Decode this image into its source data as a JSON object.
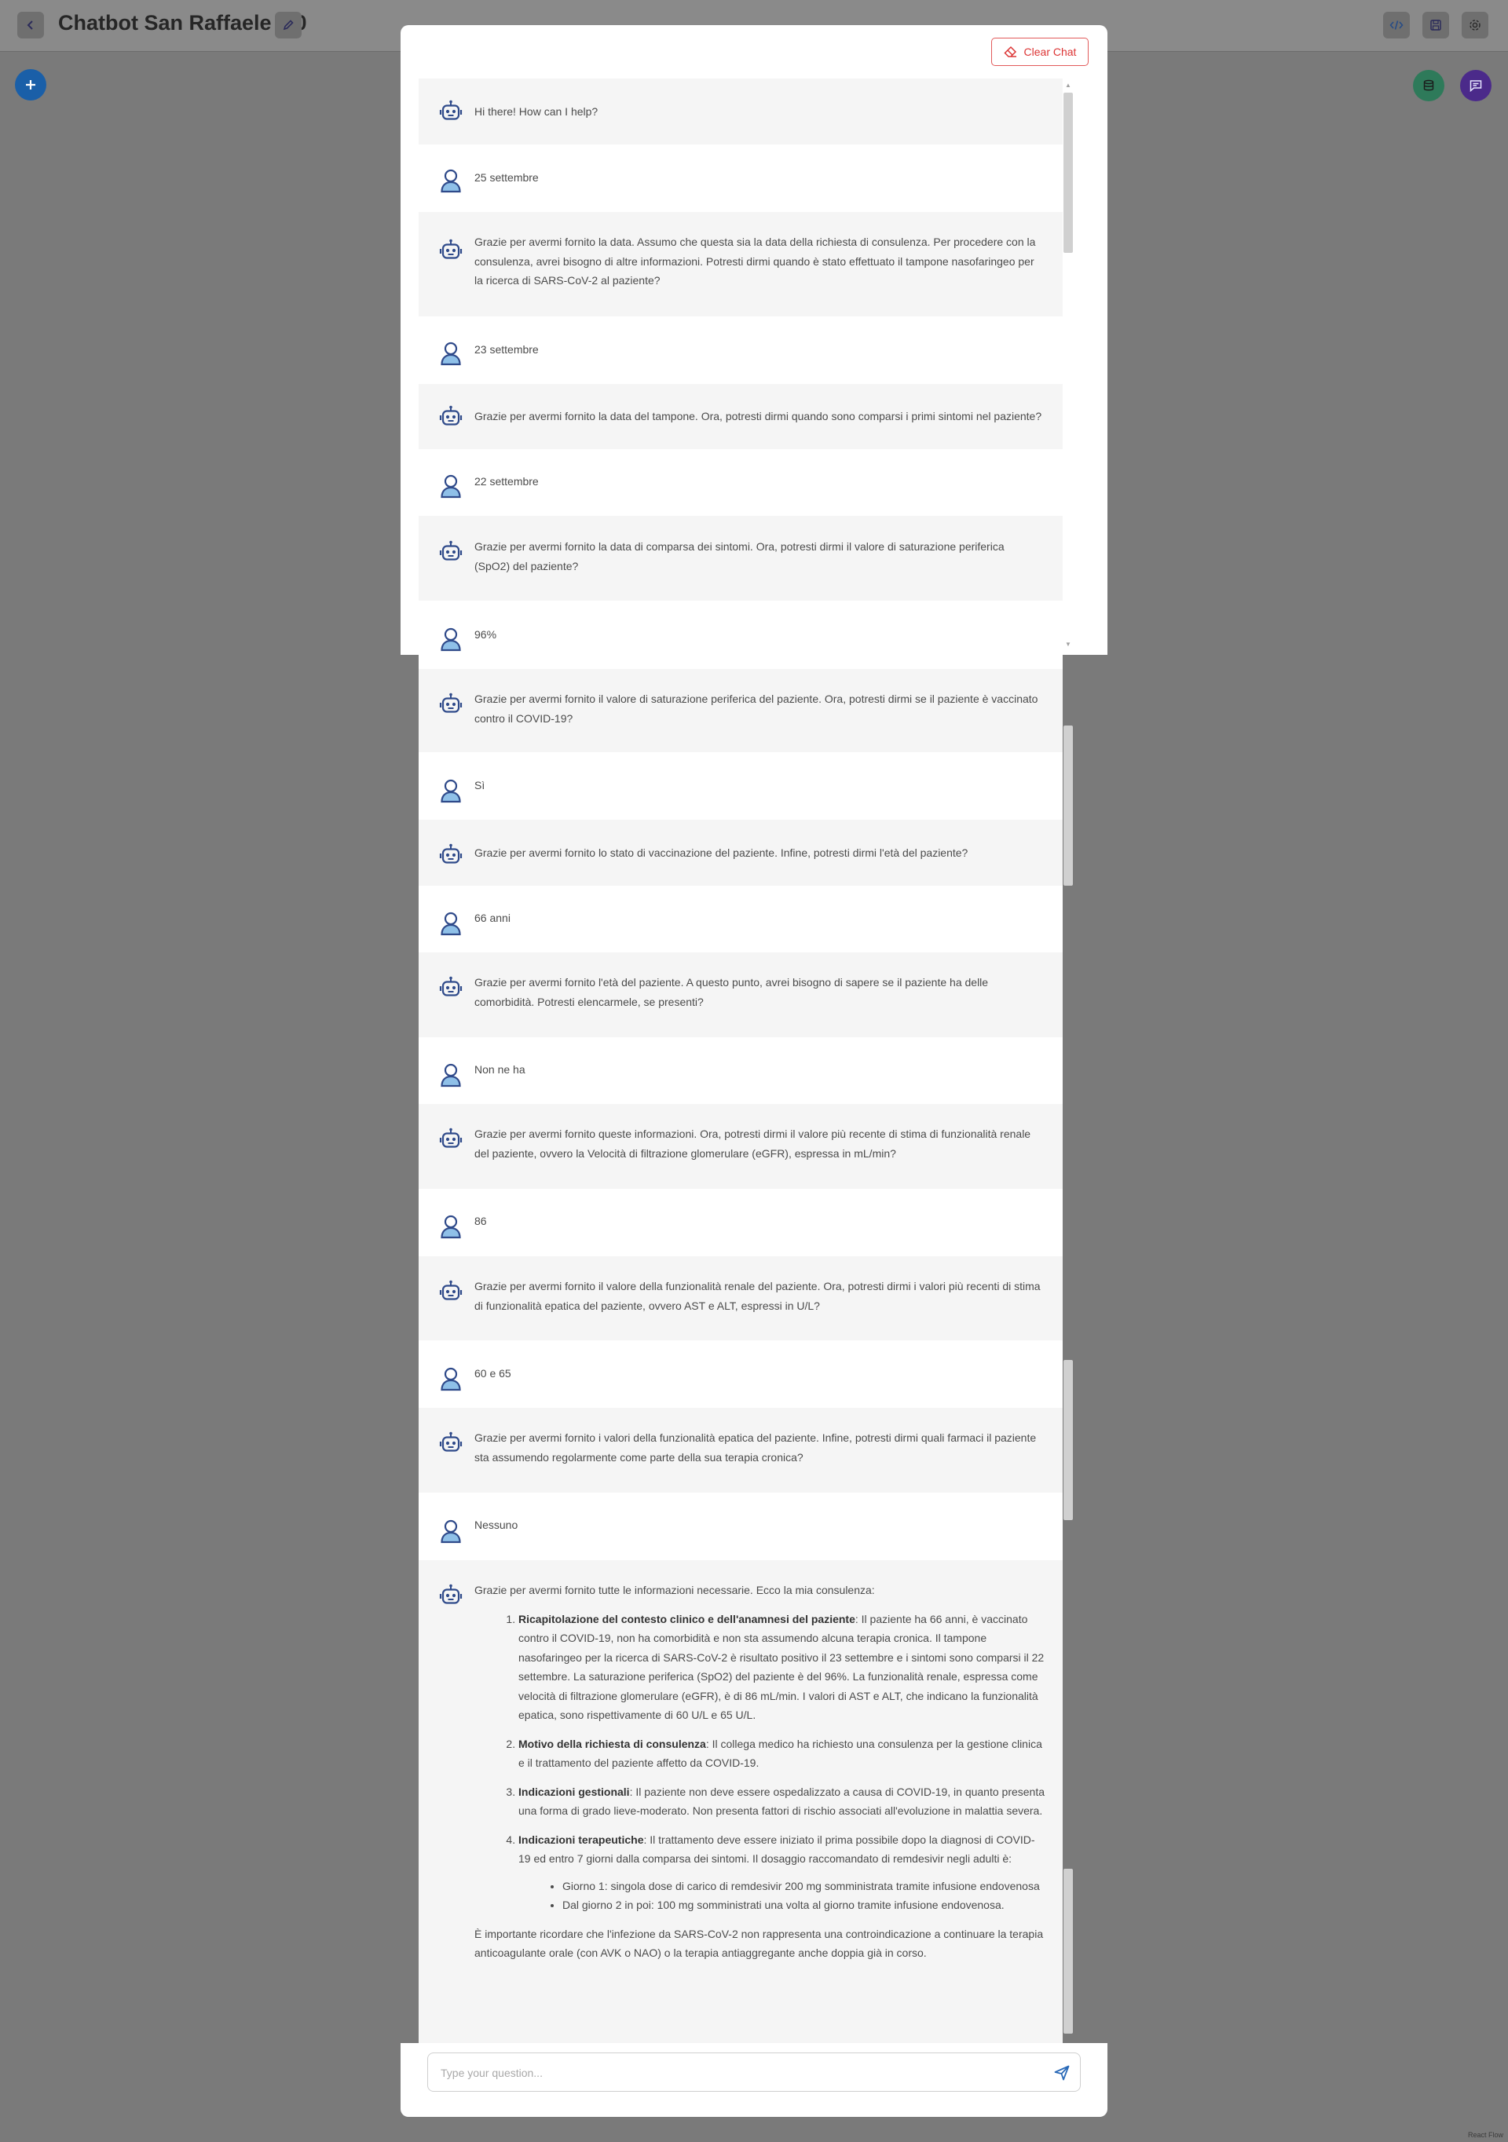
{
  "header": {
    "title": "Chatbot San Raffaele 2.0",
    "back_icon": "chevron-left-icon",
    "edit_icon": "pencil-icon",
    "code_icon": "code-icon",
    "save_icon": "save-icon",
    "settings_icon": "gear-icon"
  },
  "fab": {
    "add_icon": "plus-icon",
    "db_icon": "database-icon",
    "chat_icon": "chat-icon"
  },
  "chat": {
    "clear_label": "Clear Chat",
    "input_placeholder": "Type your question...",
    "messages": [
      {
        "role": "bot",
        "text": "Hi there! How can I help?"
      },
      {
        "role": "user",
        "text": "25 settembre"
      },
      {
        "role": "bot",
        "text": "Grazie per avermi fornito la data. Assumo che questa sia la data della richiesta di consulenza. Per procedere con la consulenza, avrei bisogno di altre informazioni. Potresti dirmi quando è stato effettuato il tampone nasofaringeo per la ricerca di SARS-CoV-2 al paziente?"
      },
      {
        "role": "user",
        "text": "23 settembre"
      },
      {
        "role": "bot",
        "text": "Grazie per avermi fornito la data del tampone. Ora, potresti dirmi quando sono comparsi i primi sintomi nel paziente?"
      },
      {
        "role": "user",
        "text": "22 settembre"
      },
      {
        "role": "bot",
        "text": "Grazie per avermi fornito la data di comparsa dei sintomi. Ora, potresti dirmi il valore di saturazione periferica (SpO2) del paziente?"
      },
      {
        "role": "user",
        "text": "96%"
      },
      {
        "role": "bot",
        "text": "Grazie per avermi fornito il valore di saturazione periferica del paziente. Ora, potresti dirmi se il paziente è vaccinato contro il COVID-19?"
      },
      {
        "role": "user",
        "text": "Sì"
      },
      {
        "role": "bot",
        "text": "Grazie per avermi fornito lo stato di vaccinazione del paziente. Infine, potresti dirmi l'età del paziente?"
      },
      {
        "role": "user",
        "text": "66 anni"
      },
      {
        "role": "bot",
        "text": "Grazie per avermi fornito l'età del paziente. A questo punto, avrei bisogno di sapere se il paziente ha delle comorbidità. Potresti elencarmele, se presenti?"
      },
      {
        "role": "user",
        "text": "Non ne ha"
      },
      {
        "role": "bot",
        "text": "Grazie per avermi fornito queste informazioni. Ora, potresti dirmi il valore più recente di stima di funzionalità renale del paziente, ovvero la Velocità di filtrazione glomerulare (eGFR), espressa in mL/min?"
      },
      {
        "role": "user",
        "text": "86"
      },
      {
        "role": "bot",
        "text": "Grazie per avermi fornito il valore della funzionalità renale del paziente. Ora, potresti dirmi i valori più recenti di stima di funzionalità epatica del paziente, ovvero AST e ALT, espressi in U/L?"
      },
      {
        "role": "user",
        "text": "60 e 65"
      },
      {
        "role": "bot",
        "text": "Grazie per avermi fornito i valori della funzionalità epatica del paziente. Infine, potresti dirmi quali farmaci il paziente sta assumendo regolarmente come parte della sua terapia cronica?"
      },
      {
        "role": "user",
        "text": "Nessuno"
      }
    ],
    "final": {
      "intro": "Grazie per avermi fornito tutte le informazioni necessarie. Ecco la mia consulenza:",
      "items": [
        {
          "title": "Ricapitolazione del contesto clinico e dell'anamnesi del paziente",
          "text": ": Il paziente ha 66 anni, è vaccinato contro il COVID-19, non ha comorbidità e non sta assumendo alcuna terapia cronica. Il tampone nasofaringeo per la ricerca di SARS-CoV-2 è risultato positivo il 23 settembre e i sintomi sono comparsi il 22 settembre. La saturazione periferica (SpO2) del paziente è del 96%. La funzionalità renale, espressa come velocità di filtrazione glomerulare (eGFR), è di 86 mL/min. I valori di AST e ALT, che indicano la funzionalità epatica, sono rispettivamente di 60 U/L e 65 U/L."
        },
        {
          "title": "Motivo della richiesta di consulenza",
          "text": ": Il collega medico ha richiesto una consulenza per la gestione clinica e il trattamento del paziente affetto da COVID-19."
        },
        {
          "title": "Indicazioni gestionali",
          "text": ": Il paziente non deve essere ospedalizzato a causa di COVID-19, in quanto presenta una forma di grado lieve-moderato. Non presenta fattori di rischio associati all'evoluzione in malattia severa."
        },
        {
          "title": "Indicazioni terapeutiche",
          "text": ": Il trattamento deve essere iniziato il prima possibile dopo la diagnosi di COVID-19 ed entro 7 giorni dalla comparsa dei sintomi. Il dosaggio raccomandato di remdesivir negli adulti è:"
        }
      ],
      "sub_items": [
        "Giorno 1: singola dose di carico di remdesivir 200 mg somministrata tramite infusione endovenosa",
        "Dal giorno 2 in poi: 100 mg somministrati una volta al giorno tramite infusione endovenosa."
      ],
      "outro": "È importante ricordare che l'infezione da SARS-CoV-2 non rappresenta una controindicazione a continuare la terapia anticoagulante orale (con AVK o NAO) o la terapia antiaggregante anche doppia già in corso."
    }
  },
  "footer": {
    "attribution": "React Flow"
  },
  "colors": {
    "backdrop": "#7a7a7a",
    "bot_bg": "#f5f5f5",
    "accent_red": "#dc3535",
    "avatar_blue": "#2f4a8a",
    "fab_blue": "#1a5fa8",
    "fab_green": "#2e7a5a",
    "fab_purple": "#4b2a8a"
  }
}
